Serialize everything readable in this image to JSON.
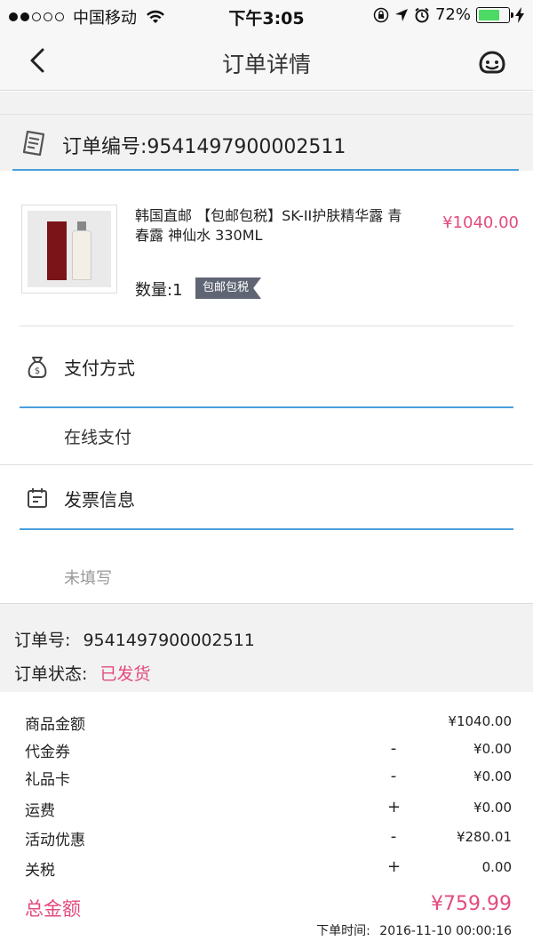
{
  "status_bar": {
    "carrier": "中国移动",
    "time": "下午3:05",
    "battery": "72%",
    "battery_level": 0.72
  },
  "nav": {
    "title": "订单详情",
    "back_icon": "chevron-left-icon",
    "service_icon": "customer-service-icon"
  },
  "order_header": {
    "label": "订单编号:9541497900002511"
  },
  "product": {
    "name": "韩国直邮 【包邮包税】SK-II护肤精华露 青春露 神仙水 330ML",
    "price": "¥1040.00",
    "quantity": "数量:1",
    "badge": "包邮包税"
  },
  "payment": {
    "title": "支付方式",
    "value": "在线支付"
  },
  "invoice": {
    "title": "发票信息",
    "value": "未填写"
  },
  "order_info": {
    "number_label": "订单号:",
    "number": "9541497900002511",
    "status_label": "订单状态:",
    "status": "已发货"
  },
  "summary": {
    "rows": [
      {
        "label": "商品金额",
        "sign": "",
        "value": "¥1040.00"
      },
      {
        "label": "代金券",
        "sign": "-",
        "value": "¥0.00"
      },
      {
        "label": "礼品卡",
        "sign": "-",
        "value": "¥0.00"
      },
      {
        "label": "运费",
        "sign": "+",
        "value": "¥0.00"
      },
      {
        "label": "活动优惠",
        "sign": "-",
        "value": "¥280.01"
      },
      {
        "label": "关税",
        "sign": "+",
        "value": "0.00"
      }
    ],
    "total_label": "总金额",
    "total_value": "¥759.99",
    "time_label": "下单时间:",
    "time_value": "2016-11-10 00:00:16"
  },
  "colors": {
    "accent_pink": "#e24b7d",
    "accent_blue": "#4a9fdc",
    "battery_green": "#4cd964"
  }
}
